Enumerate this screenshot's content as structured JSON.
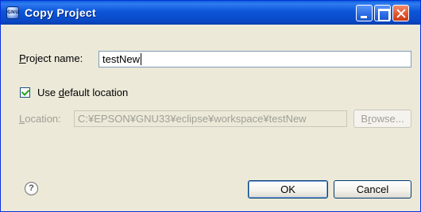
{
  "window": {
    "title": "Copy Project",
    "app_icon_text": "GNU"
  },
  "form": {
    "project_name_label_mnemonic": "P",
    "project_name_label_rest": "roject name:",
    "project_name_value": "testNew",
    "use_default_prefix": "Use ",
    "use_default_mnemonic": "d",
    "use_default_rest": "efault location",
    "use_default_checked": true,
    "location_label_mnemonic": "L",
    "location_label_rest": "ocation:",
    "location_value": "C:¥EPSON¥GNU33¥eclipse¥workspace¥testNew",
    "browse_label_prefix": "B",
    "browse_label_mnemonic": "r",
    "browse_label_rest": "owse..."
  },
  "footer": {
    "help_glyph": "?",
    "ok_label": "OK",
    "cancel_label": "Cancel"
  },
  "colors": {
    "titlebar_blue": "#0a4bc9",
    "dialog_bg": "#ece9d8",
    "checkmark_green": "#21a121"
  }
}
